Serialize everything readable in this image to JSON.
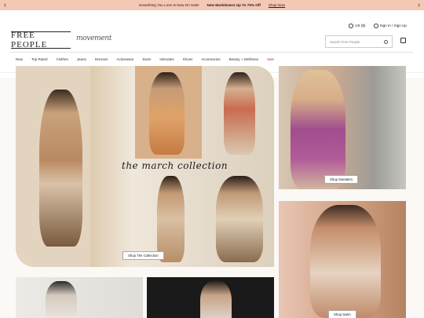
{
  "promo": {
    "left_arrow": "‹",
    "right_arrow": "›",
    "text": "Something You Love Is Now On Sale!",
    "bold": "New Markdowns Up To 75% Off",
    "link": "Shop Now"
  },
  "account": {
    "locale": "US ($)",
    "signin": "Sign In / Sign Up"
  },
  "brand": {
    "logo": "FREE PEOPLE",
    "sub_logo": "movement"
  },
  "search": {
    "placeholder": "Search Free People"
  },
  "nav": [
    "New",
    "Top Rated",
    "Clothes",
    "Jeans",
    "Dresses",
    "Activewear",
    "Swim",
    "Intimates",
    "Shoes",
    "Accessories",
    "Beauty + Wellness",
    "Sale"
  ],
  "hero": {
    "script_title": "the march collection",
    "cta": "Shop The Collection"
  },
  "tiles": {
    "sweaters_cta": "Shop Sweaters",
    "swim_cta": "Shop Swim"
  },
  "colors": {
    "promo_bg": "#f4c8b4",
    "sale": "#c0392b"
  }
}
